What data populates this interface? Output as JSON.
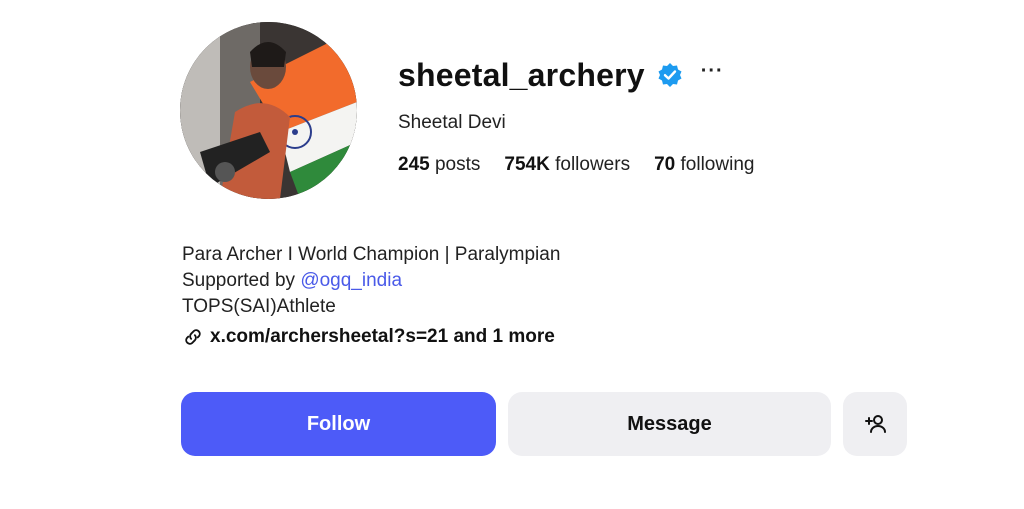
{
  "profile": {
    "username": "sheetal_archery",
    "full_name": "Sheetal Devi",
    "verified_icon": "verified-badge-icon",
    "more_label": "···"
  },
  "stats": {
    "posts_count": "245",
    "posts_label": "posts",
    "followers_count": "754K",
    "followers_label": "followers",
    "following_count": "70",
    "following_label": "following"
  },
  "bio": {
    "line1": "Para Archer I World Champion | Paralympian",
    "line2_prefix": "Supported by ",
    "line2_mention": "@ogq_india",
    "line3": "TOPS(SAI)Athlete",
    "link_text": "x.com/archersheetal?s=21 and 1 more"
  },
  "actions": {
    "follow_label": "Follow",
    "message_label": "Message",
    "suggest_icon": "add-person-icon"
  },
  "colors": {
    "accent": "#4d5bf8",
    "mention": "#4a5ae8",
    "verified": "#1d9bf0",
    "secondary_button": "#efeff2"
  }
}
